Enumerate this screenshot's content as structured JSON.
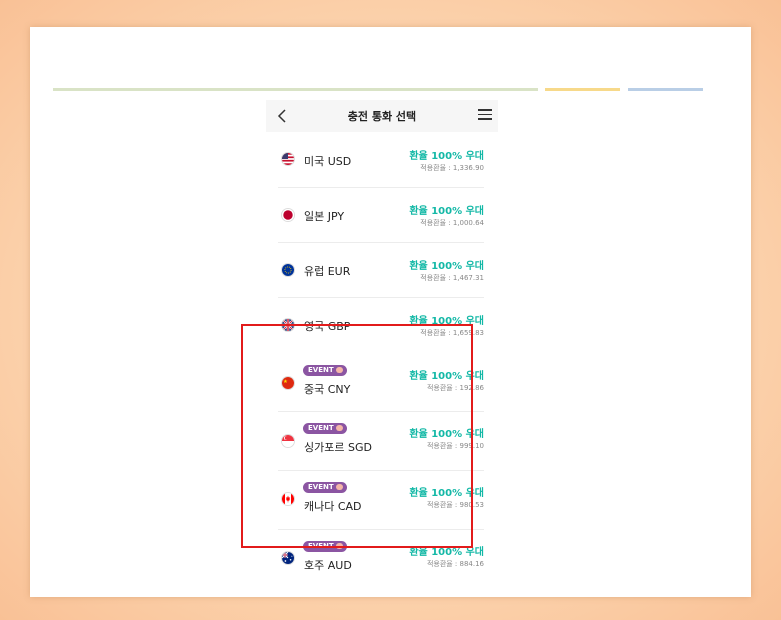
{
  "header": {
    "title": "충전 통화 선택"
  },
  "currencies": [
    {
      "flag": "us-flag-icon",
      "name": "미국 USD",
      "benefit": "환율 100% 우대",
      "applied_rate": "적용환율 : 1,336.90",
      "event": false
    },
    {
      "flag": "jp-flag-icon",
      "name": "일본 JPY",
      "benefit": "환율 100% 우대",
      "applied_rate": "적용환율 : 1,000.64",
      "event": false
    },
    {
      "flag": "eu-flag-icon",
      "name": "유럽 EUR",
      "benefit": "환율 100% 우대",
      "applied_rate": "적용환율 : 1,467.31",
      "event": false
    },
    {
      "flag": "uk-flag-icon",
      "name": "영국 GBP",
      "benefit": "환율 100% 우대",
      "applied_rate": "적용환율 : 1,659.83",
      "event": false
    },
    {
      "flag": "cn-flag-icon",
      "name": "중국 CNY",
      "benefit": "환율 100% 우대",
      "applied_rate": "적용환율 : 192.86",
      "event": true,
      "badge": "EVENT"
    },
    {
      "flag": "sg-flag-icon",
      "name": "싱가포르 SGD",
      "benefit": "환율 100% 우대",
      "applied_rate": "적용환율 : 999.10",
      "event": true,
      "badge": "EVENT"
    },
    {
      "flag": "ca-flag-icon",
      "name": "캐나다 CAD",
      "benefit": "환율 100% 우대",
      "applied_rate": "적용환율 : 980.53",
      "event": true,
      "badge": "EVENT"
    },
    {
      "flag": "au-flag-icon",
      "name": "호주 AUD",
      "benefit": "환율 100% 우대",
      "applied_rate": "적용환율 : 884.16",
      "event": true,
      "badge": "EVENT"
    }
  ],
  "colors": {
    "accent": "#13b8a6",
    "event_badge": "#8b55a2",
    "highlight": "#e21b1b"
  }
}
